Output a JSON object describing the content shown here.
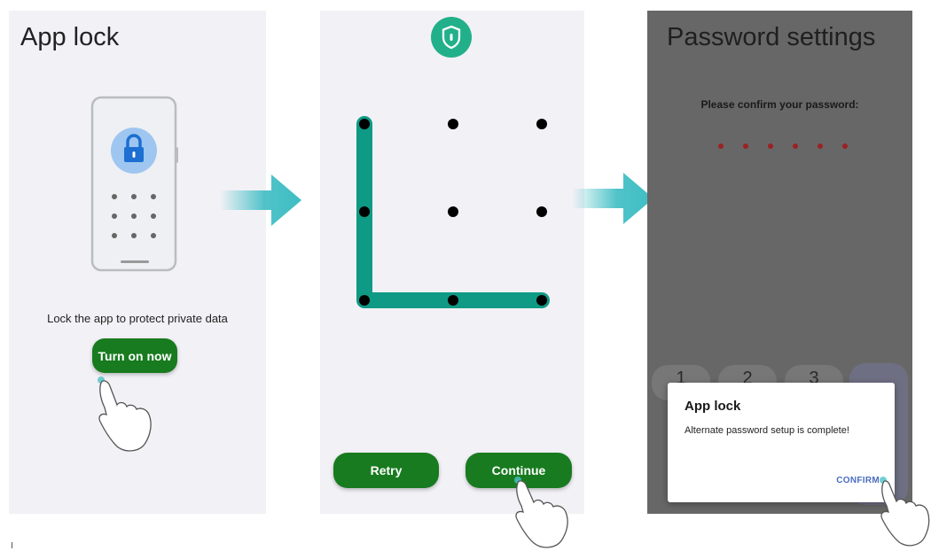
{
  "panel1": {
    "title": "App lock",
    "description": "Lock the app to protect private data",
    "turn_on_label": "Turn on now",
    "icons": {
      "lock": "lock-icon",
      "hand": "hand-pointer-icon"
    }
  },
  "panel2": {
    "shield_icon": "shield-icon",
    "pattern": {
      "grid": "3x3",
      "selected_nodes": [
        1,
        4,
        7,
        8,
        9
      ]
    },
    "retry_label": "Retry",
    "continue_label": "Continue"
  },
  "panel3": {
    "title": "Password settings",
    "prompt": "Please confirm your password:",
    "password_dot_count": 6,
    "keypad_visible": [
      "1",
      "2",
      "3"
    ],
    "dialog": {
      "title": "App lock",
      "message": "Alternate password setup is complete!",
      "confirm_label": "CONFIRM"
    }
  },
  "colors": {
    "green_button": "#187b1f",
    "pattern_line": "#0e9a84",
    "arrow": "#3dbdc3",
    "shield": "#22b08b",
    "lock_badge": "#9ec6f1",
    "password_dot": "#9b2222",
    "overlay": "#676767"
  }
}
